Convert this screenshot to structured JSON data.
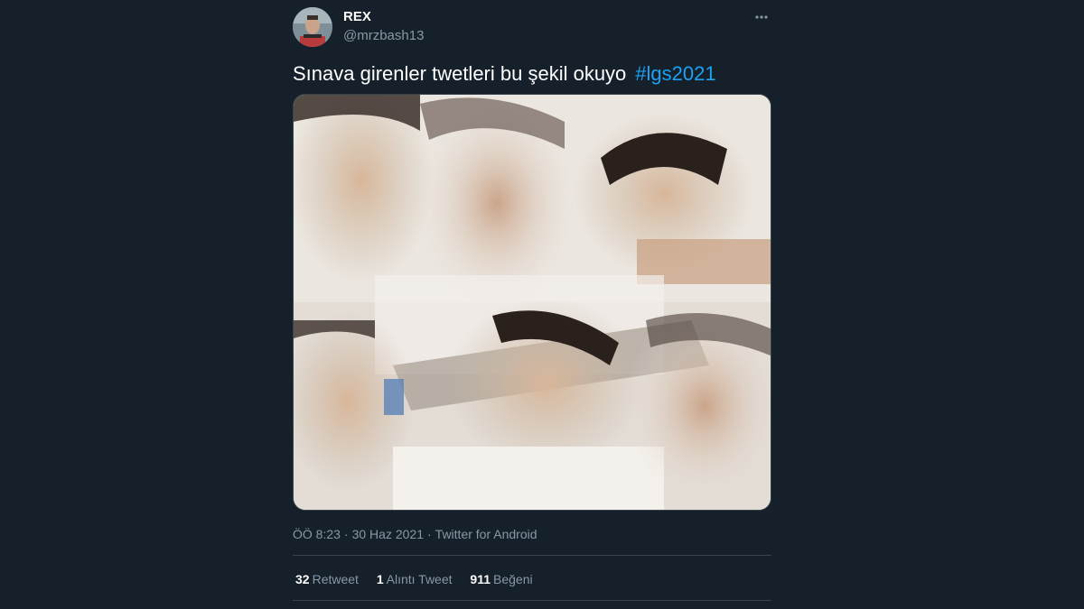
{
  "user": {
    "display_name": "REX",
    "handle": "@mrzbash13"
  },
  "tweet": {
    "text": "Sınava girenler twetleri bu şekil okuyo",
    "hashtag": "#lgs2021"
  },
  "meta": {
    "time": "ÖÖ 8:23",
    "date": "30 Haz 2021",
    "source": "Twitter for Android",
    "separator": "·"
  },
  "stats": {
    "retweets": {
      "count": "32",
      "label": "Retweet"
    },
    "quotes": {
      "count": "1",
      "label": "Alıntı Tweet"
    },
    "likes": {
      "count": "911",
      "label": "Beğeni"
    }
  },
  "icons": {
    "more": "more-horizontal-icon",
    "avatar": "avatar"
  },
  "colors": {
    "background": "#15202b",
    "accent": "#1da1f2",
    "secondary_text": "#8899a6",
    "divider": "#38444d"
  }
}
